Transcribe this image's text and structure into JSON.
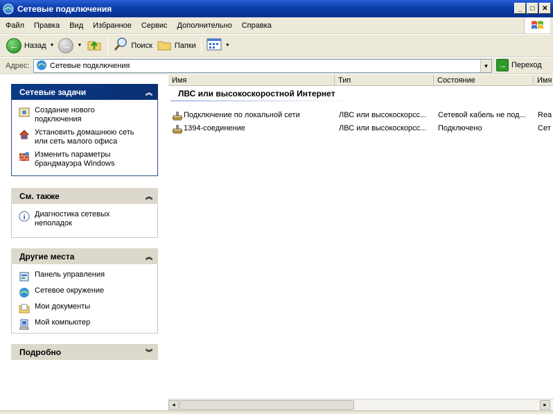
{
  "window": {
    "title": "Сетевые подключения"
  },
  "menu": [
    "Файл",
    "Правка",
    "Вид",
    "Избранное",
    "Сервис",
    "Дополнительно",
    "Справка"
  ],
  "toolbar": {
    "back_label": "Назад",
    "search_label": "Поиск",
    "folders_label": "Папки"
  },
  "address": {
    "label": "Адрес:",
    "value": "Сетевые подключения",
    "go_label": "Переход"
  },
  "taskpane": {
    "network_tasks": {
      "title": "Сетевые задачи",
      "items": [
        {
          "line1": "Создание нового",
          "line2": "подключения"
        },
        {
          "line1": "Установить домашнюю сеть",
          "line2": "или сеть малого офиса"
        },
        {
          "line1": "Изменить параметры",
          "line2": "брандмауэра Windows"
        }
      ]
    },
    "see_also": {
      "title": "См. также",
      "items": [
        {
          "line1": "Диагностика сетевых",
          "line2": "неполадок"
        }
      ]
    },
    "other_places": {
      "title": "Другие места",
      "items": [
        "Панель управления",
        "Сетевое окружение",
        "Мои документы",
        "Мой компьютер"
      ]
    },
    "details": {
      "title": "Подробно"
    }
  },
  "columns": [
    "Имя",
    "Тип",
    "Состояние",
    "Имя"
  ],
  "group": {
    "title": "ЛВС или высокоскоростной Интернет"
  },
  "connections": [
    {
      "name": "Подключение по локальной сети",
      "type": "ЛВС или высокоскорсс...",
      "status": "Сетевой кабель не под...",
      "device": "Rea"
    },
    {
      "name": "1394-соединение",
      "type": "ЛВС или высокоскорсс...",
      "status": "Подключено",
      "device": "Сет"
    }
  ]
}
